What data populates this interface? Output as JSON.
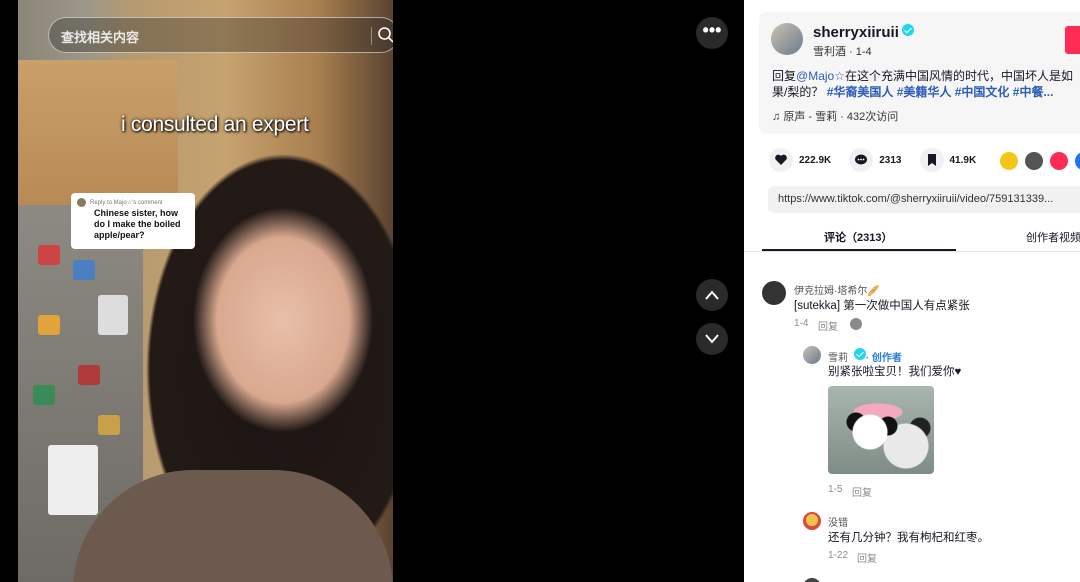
{
  "video": {
    "search_placeholder": "查找相关内容",
    "caption": "i consulted an expert",
    "reply_card": {
      "header": "Reply to Majo☆'s comment",
      "text": "Chinese sister, how do I make the boiled apple/pear?"
    },
    "more_label": "•••"
  },
  "post": {
    "author_name": "sherryxiiruii",
    "author_sub": "雪利酒 · 1-4",
    "desc_prefix": "回复",
    "desc_mention": "@Majo☆",
    "desc_text": "在这个充满中国风情的时代，中国坏人是如",
    "desc_line2": "果/梨的？",
    "tags": [
      "#华裔美国人",
      "#美籍华人",
      "#中国文化",
      "#中餐..."
    ],
    "music": "原声 - 雪莉 · 432次访问",
    "likes": "222.9K",
    "comments": "2313",
    "saves": "41.9K",
    "url": "https://www.tiktok.com/@sherryxiiruii/video/759131339..."
  },
  "tabs": {
    "comments": "评论（2313）",
    "creator_videos": "创作者视频"
  },
  "comments": [
    {
      "name": "伊克拉姆·塔希尔🥖",
      "text": "[sutekka] 第一次做中国人有点紧张",
      "date": "1-4",
      "reply": "回复"
    },
    {
      "name": "雪莉",
      "creator_label": "· 创作者",
      "text": "别紧张啦宝贝！我们爱你♥",
      "date": "1-5",
      "reply": "回复"
    },
    {
      "name": "没错",
      "text": "还有几分钟？我有枸杞和红枣。",
      "date": "1-22",
      "reply": "回复"
    }
  ]
}
